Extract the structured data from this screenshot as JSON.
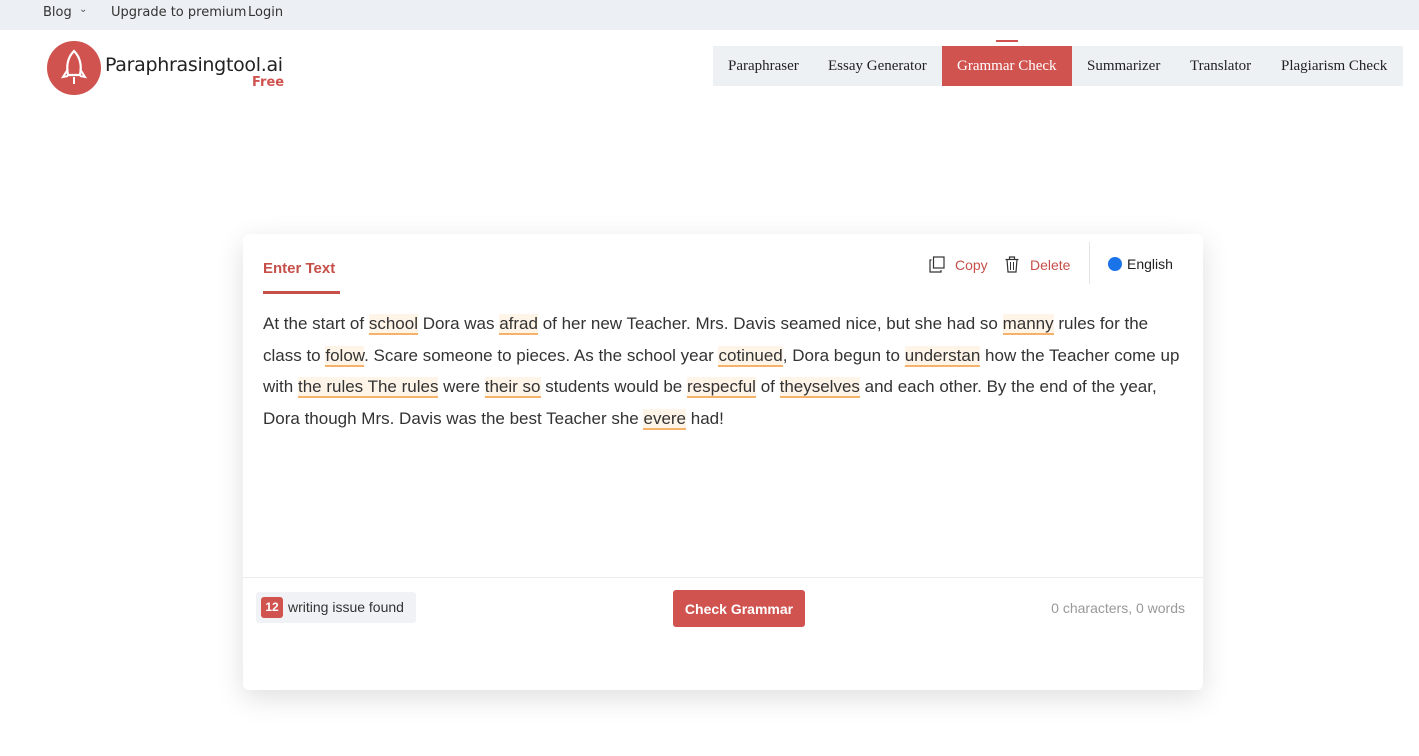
{
  "topbar": {
    "blog": "Blog",
    "upgrade": "Upgrade to premium",
    "login": "Login"
  },
  "logo": {
    "name": "Paraphrasingtool.ai",
    "tag": "Free"
  },
  "nav": [
    {
      "label": "Paraphraser"
    },
    {
      "label": "Essay Generator"
    },
    {
      "label": "Grammar Check"
    },
    {
      "label": "Summarizer"
    },
    {
      "label": "Translator"
    },
    {
      "label": "Plagiarism Check"
    }
  ],
  "editor": {
    "tab_label": "Enter Text",
    "copy": "Copy",
    "delete": "Delete",
    "language": "English",
    "text": [
      {
        "t": "At the start of "
      },
      {
        "t": "school",
        "e": true
      },
      {
        "t": " Dora was "
      },
      {
        "t": "afrad",
        "e": true
      },
      {
        "t": " of her new Teacher. Mrs. Davis seamed nice, but she had so "
      },
      {
        "t": "manny",
        "e": true
      },
      {
        "t": " rules for the class to "
      },
      {
        "t": "folow",
        "e": true
      },
      {
        "t": ". Scare someone to pieces. As the school year "
      },
      {
        "t": "cotinued",
        "e": true
      },
      {
        "t": ", Dora begun to "
      },
      {
        "t": "understan",
        "e": true
      },
      {
        "t": " how the Teacher come up with "
      },
      {
        "t": "the rules The rules",
        "e": true
      },
      {
        "t": " were "
      },
      {
        "t": "their so",
        "e": true
      },
      {
        "t": " students would be "
      },
      {
        "t": "respecful",
        "e": true
      },
      {
        "t": " of "
      },
      {
        "t": "theyselves",
        "e": true
      },
      {
        "t": " and each other. By the end of the year, Dora though Mrs. Davis was the best Teacher she "
      },
      {
        "t": "evere",
        "e": true
      },
      {
        "t": " had!"
      }
    ]
  },
  "footer": {
    "issue_count": "12",
    "issue_label": "writing issue found",
    "check_button": "Check Grammar",
    "counter": "0 characters, 0 words"
  },
  "colors": {
    "brand": "#d0534f",
    "language_dot": "#1a73e8",
    "error_underline": "#f6b26b"
  }
}
